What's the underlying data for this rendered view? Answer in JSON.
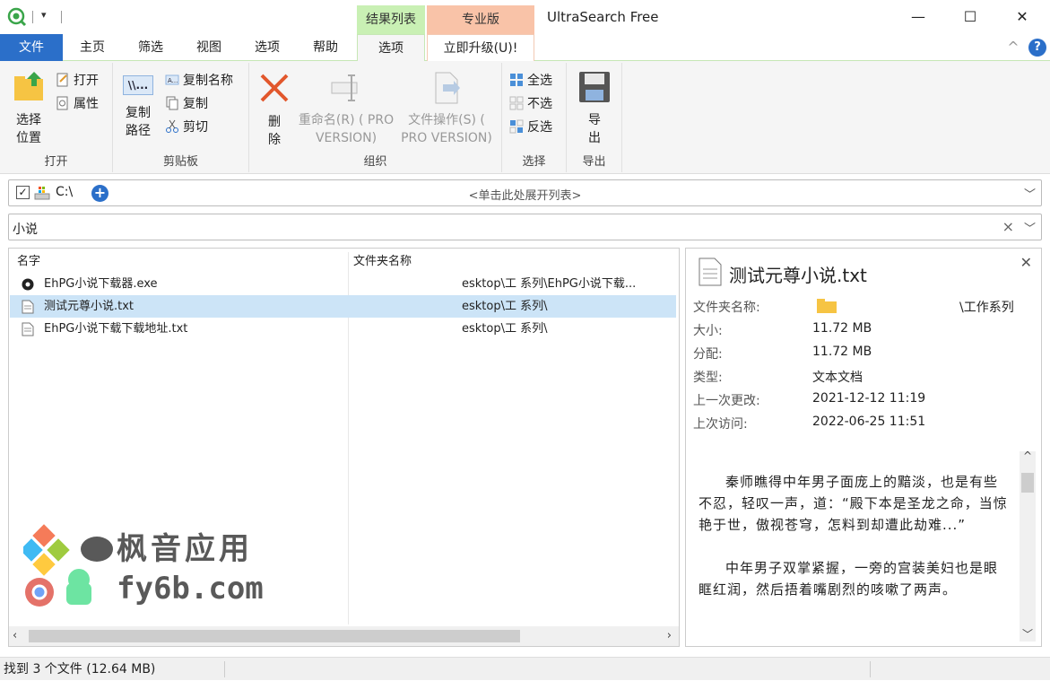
{
  "titlebar": {
    "title": "UltraSearch Free",
    "context_tab_results": "结果列表",
    "context_tab_pro": "专业版",
    "minimize": "—",
    "maximize": "☐",
    "close": "✕"
  },
  "tabs": {
    "file": "文件",
    "home": "主页",
    "filter": "筛选",
    "view": "视图",
    "options": "选项",
    "help": "帮助",
    "results_options": "选项",
    "upgrade": "立即升级(U)!",
    "collapse": "^",
    "help_icon": "?"
  },
  "ribbon": {
    "open_group": {
      "label": "打开",
      "choose_location": "选择位置",
      "open": "打开",
      "properties": "属性"
    },
    "clipboard_group": {
      "label": "剪贴板",
      "copy_path": "复制路径",
      "copy_name": "复制名称",
      "copy": "复制",
      "cut": "剪切"
    },
    "organize_group": {
      "label": "组织",
      "delete": "删除",
      "rename": "重命名(R) ( PRO VERSION)",
      "file_ops": "文件操作(S) ( PRO VERSION)"
    },
    "select_group": {
      "label": "选择",
      "select_all": "全选",
      "select_none": "不选",
      "invert": "反选"
    },
    "export_group": {
      "label": "导出",
      "export": "导出"
    }
  },
  "address": {
    "drive": "C:\\",
    "expand_hint": "<单击此处展开列表>"
  },
  "search": {
    "value": "小说",
    "clear": "×"
  },
  "list": {
    "headers": {
      "name": "名字",
      "folder": "文件夹名称"
    },
    "rows": [
      {
        "name": "EhPG小说下载器.exe",
        "folder": "esktop\\工   系列\\EhPG小说下载...",
        "icon": "exe-icon"
      },
      {
        "name": "测试元尊小说.txt",
        "folder": "esktop\\工  系列\\",
        "icon": "text-file-icon"
      },
      {
        "name": "EhPG小说下载下载地址.txt",
        "folder": "esktop\\工  系列\\",
        "icon": "text-file-icon"
      }
    ]
  },
  "preview": {
    "filename": "测试元尊小说.txt",
    "props": [
      {
        "label": "文件夹名称:",
        "value": "\\工作系列"
      },
      {
        "label": "大小:",
        "value": "11.72 MB"
      },
      {
        "label": "分配:",
        "value": "11.72 MB"
      },
      {
        "label": "类型:",
        "value": "文本文档"
      },
      {
        "label": "上一次更改:",
        "value": "2021-12-12 11:19"
      },
      {
        "label": "上次访问:",
        "value": "2022-06-25 11:51"
      }
    ],
    "text_p1": "秦师瞧得中年男子面庞上的黯淡，也是有些不忍，轻叹一声，道：“殿下本是圣龙之命，当惊艳于世，傲视苍穹，怎料到却遭此劫难...”",
    "text_p2": "中年男子双掌紧握，一旁的宫装美妇也是眼眶红润，然后捂着嘴剧烈的咳嗽了两声。"
  },
  "watermark": {
    "cn": "枫音应用",
    "en": "fy6b.com"
  },
  "status": {
    "text": "找到 3 个文件 (12.64 MB)"
  }
}
